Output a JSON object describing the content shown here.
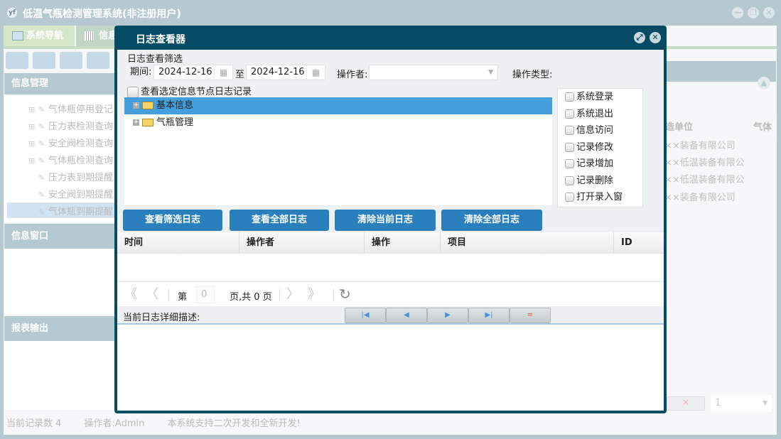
{
  "app": {
    "title": "低温气瓶检测管理系统(非注册用户)",
    "logo": "yf",
    "win_buttons": [
      "minimize-icon",
      "restore-icon",
      "close-icon"
    ]
  },
  "tabs": [
    {
      "label": "系统导航"
    },
    {
      "label": "信息"
    }
  ],
  "left": {
    "info_mgmt": "信息管理",
    "tree": [
      "气体瓶停用登记",
      "压力表检测查询",
      "安全阀检测查询",
      "气体瓶检测查询",
      "压力表到期提醒",
      "安全阀到期提醒",
      "气体瓶到期提醒"
    ],
    "info_window": "信息窗口",
    "report": "报表输出"
  },
  "right": {
    "columns": [
      "造单位",
      "气体"
    ],
    "rows": [
      "××装备有限公司",
      "××低温装备有限公",
      "××低温装备有限公",
      "××装备有限公司"
    ],
    "page_select": "1"
  },
  "status": {
    "records": "当前记录数 4",
    "operator": "操作者:Admin",
    "note": "本系统支持二次开发和全新开发!"
  },
  "modal": {
    "title": "日志查看器",
    "filter_title": "日志查看筛选",
    "period_label": "期间:",
    "date_from": "2024-12-16",
    "to_label": "至",
    "date_to": "2024-12-16",
    "operator_label": "操作者:",
    "operator_value": "",
    "optype_label": "操作类型:",
    "node_check_label": "查看选定信息节点日志记录",
    "tree": [
      {
        "label": "基本信息",
        "selected": true
      },
      {
        "label": "气瓶管理",
        "selected": false
      }
    ],
    "optypes": [
      "系统登录",
      "系统退出",
      "信息访问",
      "记录修改",
      "记录增加",
      "记录删除",
      "打开录入窗"
    ],
    "buttons": [
      "查看筛选日志",
      "查看全部日志",
      "清除当前日志",
      "清除全部日志"
    ],
    "columns": [
      "时间",
      "操作者",
      "操作",
      "项目",
      "ID"
    ],
    "pager": {
      "page_label": "第",
      "page_value": "0",
      "total_label": "页,共 0 页"
    },
    "detail_label": "当前日志详细描述:",
    "accent": "#2a80bd",
    "header_color": "#064b63"
  }
}
